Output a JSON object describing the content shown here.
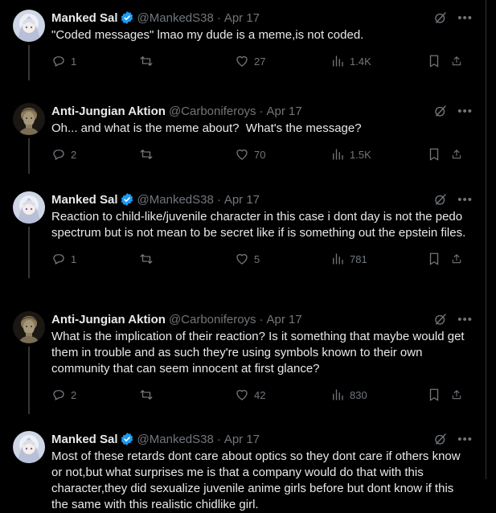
{
  "colors": {
    "background": "#000000",
    "text": "#e7e9ea",
    "muted": "#71767b",
    "verified": "#1d9bf0",
    "thread_line": "#333639"
  },
  "tweets": [
    {
      "name": "Manked Sal",
      "verified": true,
      "handle": "@MankedS38",
      "dot": "·",
      "date": "Apr 17",
      "text": "\"Coded messages\" lmao my dude is a meme,is not coded.",
      "replies": "1",
      "retweets": "",
      "likes": "27",
      "views": "1.4K",
      "avatar": "anime-girl"
    },
    {
      "name": "Anti-Jungian Aktion",
      "verified": false,
      "handle": "@Carboniferoys",
      "dot": "·",
      "date": "Apr 17",
      "text": "Oh... and what is the meme about?  What's the message?",
      "replies": "2",
      "retweets": "",
      "likes": "70",
      "views": "1.5K",
      "avatar": "bust-statue"
    },
    {
      "name": "Manked Sal",
      "verified": true,
      "handle": "@MankedS38",
      "dot": "·",
      "date": "Apr 17",
      "text": "Reaction to child-like/juvenile character in this case i dont day is not the pedo spectrum but is not mean to be secret like if is something out the epstein files.",
      "replies": "1",
      "retweets": "",
      "likes": "5",
      "views": "781",
      "avatar": "anime-girl"
    },
    {
      "name": "Anti-Jungian Aktion",
      "verified": false,
      "handle": "@Carboniferoys",
      "dot": "·",
      "date": "Apr 17",
      "text": "What is the implication of their reaction? Is it something that maybe would get them in trouble and as such they're using symbols known to their own community that can seem innocent at first glance?",
      "replies": "2",
      "retweets": "",
      "likes": "42",
      "views": "830",
      "avatar": "bust-statue"
    },
    {
      "name": "Manked Sal",
      "verified": true,
      "handle": "@MankedS38",
      "dot": "·",
      "date": "Apr 17",
      "text": "Most of these retards dont care about optics so they dont care if others know or not,but what surprises me is that a company would do that with this character,they did sexualize juvenile anime girls before but dont know if this the same with this realistic chidlike girl.",
      "replies": "",
      "retweets": "",
      "likes": "",
      "views": "",
      "avatar": "anime-girl"
    }
  ]
}
